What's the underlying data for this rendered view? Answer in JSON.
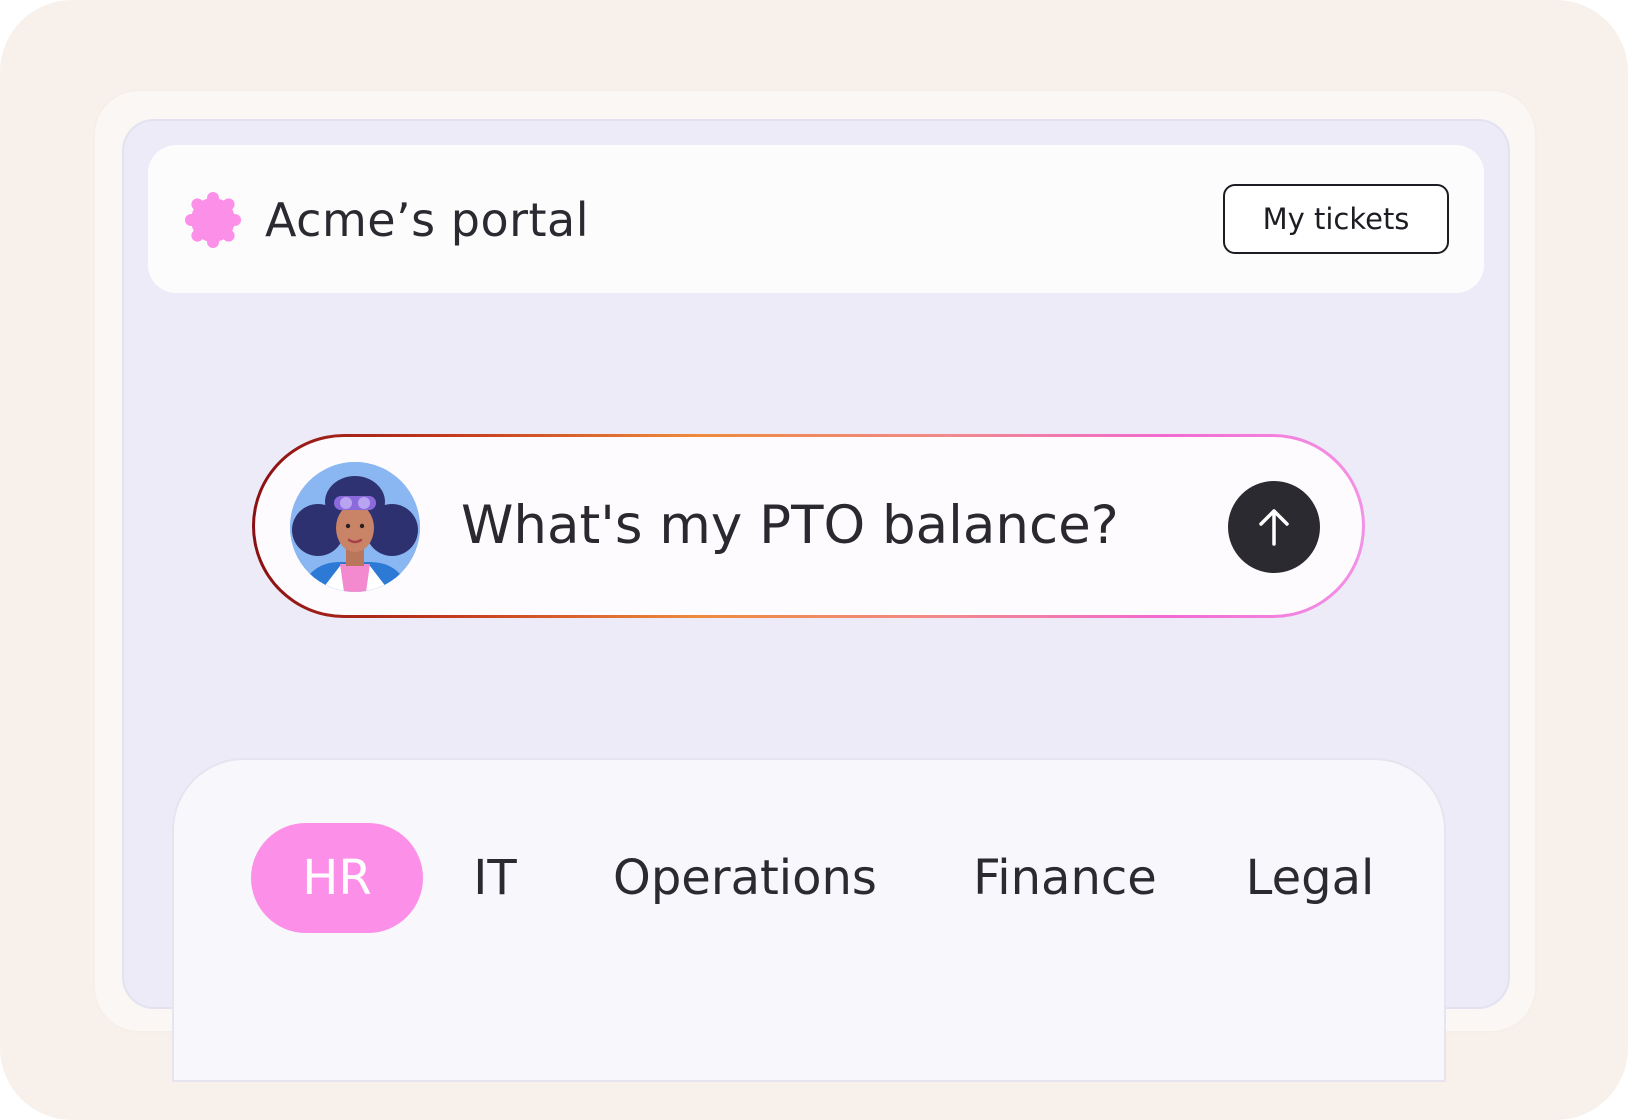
{
  "header": {
    "title": "Acme’s portal",
    "tickets_button": "My tickets",
    "logo_icon": "flower-badge-icon",
    "logo_color": "#fc8fe7"
  },
  "search": {
    "query": "What's my PTO balance?",
    "send_icon": "arrow-up-icon",
    "avatar": "user-avatar"
  },
  "tabs": [
    {
      "label": "HR",
      "active": true
    },
    {
      "label": "IT",
      "active": false
    },
    {
      "label": "Operations",
      "active": false
    },
    {
      "label": "Finance",
      "active": false
    },
    {
      "label": "Legal",
      "active": false
    }
  ],
  "colors": {
    "accent": "#fc8fe7",
    "page_bg": "#f8f1eb",
    "app_bg": "#ecebf7",
    "dark": "#2b2a30"
  }
}
